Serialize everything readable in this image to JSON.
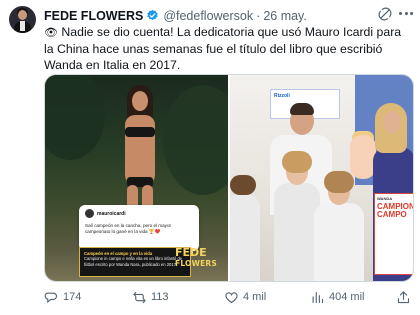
{
  "post": {
    "author_name": "FEDE FLOWERS",
    "handle": "@fedeflowersok",
    "separator": "·",
    "date": "26 may.",
    "text_eyes": "👁",
    "text": "Nadie se dio cuenta!  La dedicatoria que usó Mauro Icardi para la China hace unas semanas fue el título del libro que escribió Wanda en Italia en 2017."
  },
  "media": {
    "left": {
      "instagram_user": "mauroicardi",
      "instagram_caption": "Salí campeón en la cancha, pero el mayor campeonato lo gané en la vida 🏆❤️",
      "book_title": "Campeón en el campo y en la vida",
      "book_text": "Campione in campo e nella vita es un libro infantil de fútbol escrito por Wanda Nara, publicado en 2017.",
      "brand_line1": "FEDE",
      "brand_line2": "FLOWERS"
    },
    "right": {
      "sign_text": "Rizzoli",
      "book_kicker": "WANDA",
      "book_title": "CAMPIONE CAMPO"
    }
  },
  "actions": {
    "replies": "174",
    "reposts": "113",
    "likes": "4 mil",
    "views": "404 mil"
  },
  "colors": {
    "text_primary": "#0f1419",
    "text_secondary": "#536471",
    "verified_badge": "#1d9bf0",
    "border": "#cfd9de"
  }
}
